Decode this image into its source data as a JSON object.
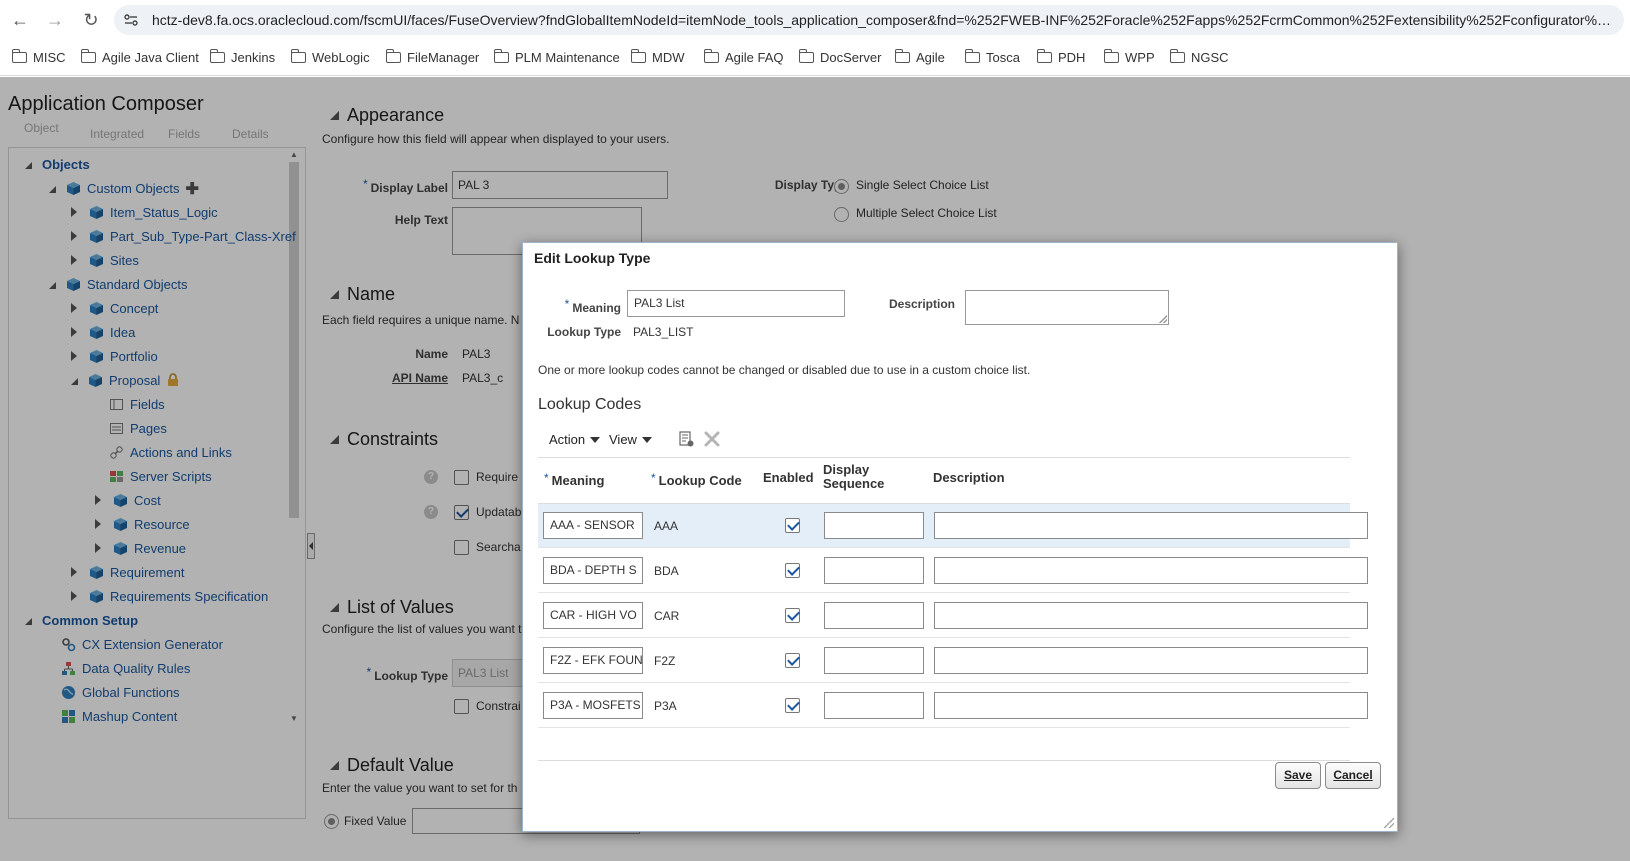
{
  "browser": {
    "url": "hctz-dev8.fa.ocs.oraclecloud.com/fscmUI/faces/FuseOverview?fndGlobalItemNodeId=itemNode_tools_application_composer&fnd=%252FWEB-INF%252Foracle%252Fapps%252FcrmCommon%252Fextensibility%252Fconfigurator%252Fp..."
  },
  "bookmarks": [
    "MISC",
    "Agile Java Client",
    "Jenkins",
    "WebLogic",
    "FileManager",
    "PLM Maintenance",
    "MDW",
    "Agile FAQ",
    "DocServer",
    "Agile",
    "Tosca",
    "PDH",
    "WPP",
    "NGSC"
  ],
  "app": {
    "title": "Application Composer",
    "ghost_row": [
      "Object",
      "Integrated",
      "Fields",
      "Details"
    ]
  },
  "tree": {
    "objects_label": "Objects",
    "custom_objects_label": "Custom Objects",
    "custom_children": [
      "Item_Status_Logic",
      "Part_Sub_Type-Part_Class-Xref",
      "Sites"
    ],
    "standard_objects_label": "Standard Objects",
    "standard_children": [
      "Concept",
      "Idea",
      "Portfolio"
    ],
    "proposal_label": "Proposal",
    "proposal_children": [
      "Fields",
      "Pages",
      "Actions and Links",
      "Server Scripts"
    ],
    "proposal_subobjects": [
      "Cost",
      "Resource",
      "Revenue"
    ],
    "more_standard": [
      "Requirement",
      "Requirements Specification"
    ],
    "common_setup_label": "Common Setup",
    "common_children": [
      "CX Extension Generator",
      "Data Quality Rules",
      "Global Functions",
      "Mashup Content"
    ]
  },
  "main": {
    "appearance": {
      "title": "Appearance",
      "desc": "Configure how this field will appear when displayed to your users.",
      "display_label_label": "Display Label",
      "display_label_value": "PAL 3",
      "help_text_label": "Help Text",
      "display_type_label": "Display Type",
      "display_type_options": [
        "Single Select Choice List",
        "Multiple Select Choice List"
      ]
    },
    "name": {
      "title": "Name",
      "desc": "Each field requires a unique name. N",
      "name_label": "Name",
      "name_value": "PAL3",
      "api_label": "API Name",
      "api_value": "PAL3_c"
    },
    "constraints": {
      "title": "Constraints",
      "items": [
        "Require",
        "Updatab",
        "Searcha"
      ]
    },
    "lov": {
      "title": "List of Values",
      "desc": "Configure the list of values you want t",
      "lookup_type_label": "Lookup Type",
      "lookup_type_value": "PAL3 List",
      "constraint_label": "Constrai"
    },
    "default_value": {
      "title": "Default Value",
      "desc": "Enter the value you want to set for th",
      "fixed_value_label": "Fixed Value"
    }
  },
  "dialog": {
    "title": "Edit Lookup Type",
    "meaning_label": "Meaning",
    "meaning_value": "PAL3 List",
    "description_label": "Description",
    "lookup_type_label": "Lookup Type",
    "lookup_type_value": "PAL3_LIST",
    "note": "One or more lookup codes cannot be changed or disabled due to use in a custom choice list.",
    "section_title": "Lookup Codes",
    "toolbar": {
      "action": "Action",
      "view": "View"
    },
    "columns": {
      "meaning": "Meaning",
      "lookup_code": "Lookup Code",
      "enabled": "Enabled",
      "display_sequence_1": "Display",
      "display_sequence_2": "Sequence",
      "description": "Description"
    },
    "rows": [
      {
        "meaning": "AAA - SENSOR",
        "code": "AAA",
        "enabled": true
      },
      {
        "meaning": "BDA - DEPTH S",
        "code": "BDA",
        "enabled": true
      },
      {
        "meaning": "CAR - HIGH VO",
        "code": "CAR",
        "enabled": true
      },
      {
        "meaning": "F2Z - EFK FOUN",
        "code": "F2Z",
        "enabled": true
      },
      {
        "meaning": "P3A - MOSFETS",
        "code": "P3A",
        "enabled": true
      }
    ],
    "save_label": "Save",
    "cancel_label": "Cancel"
  }
}
